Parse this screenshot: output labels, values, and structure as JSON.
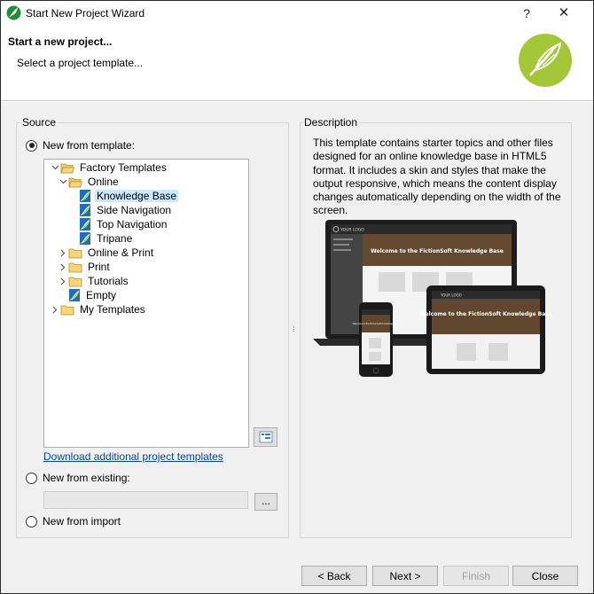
{
  "window": {
    "title": "Start New Project Wizard",
    "help_label": "?",
    "close_label": "✕"
  },
  "header": {
    "title": "Start a new project...",
    "subtitle": "Select a project template..."
  },
  "source": {
    "label": "Source",
    "new_from_template": "New from template:",
    "tree": [
      {
        "label": "Factory Templates",
        "expanded": true
      },
      {
        "label": "Online",
        "expanded": true
      },
      {
        "label": "Knowledge Base",
        "selected": true
      },
      {
        "label": "Side Navigation"
      },
      {
        "label": "Top Navigation"
      },
      {
        "label": "Tripane"
      },
      {
        "label": "Online & Print",
        "expanded": false
      },
      {
        "label": "Print",
        "expanded": false
      },
      {
        "label": "Tutorials",
        "expanded": false
      },
      {
        "label": "Empty"
      },
      {
        "label": "My Templates",
        "expanded": false
      }
    ],
    "download_link": "Download additional project templates",
    "new_from_existing": "New from existing:",
    "existing_value": "",
    "browse_label": "...",
    "new_from_import": "New from import"
  },
  "description": {
    "label": "Description",
    "text": "This template contains starter topics and other files designed for an online knowledge base in HTML5 format. It includes a skin and styles that make the output responsive, which means the content display changes automatically depending on the width of the screen.",
    "preview": {
      "logo_text": "YOUR LOGO",
      "laptop_banner": "Welcome to the FictionSoft Knowledge Base",
      "tablet_banner": "Welcome to the FictionSoft Knowledge Base",
      "phone_banner": "Welcome to the FictionSoft Knowledge Base"
    }
  },
  "buttons": {
    "back": "< Back",
    "next": "Next >",
    "finish": "Finish",
    "close": "Close"
  },
  "colors": {
    "brand_green": "#a4c639",
    "folder_yellow": "#f5d67a",
    "selection": "#cce8ff",
    "link": "#0645ad"
  }
}
